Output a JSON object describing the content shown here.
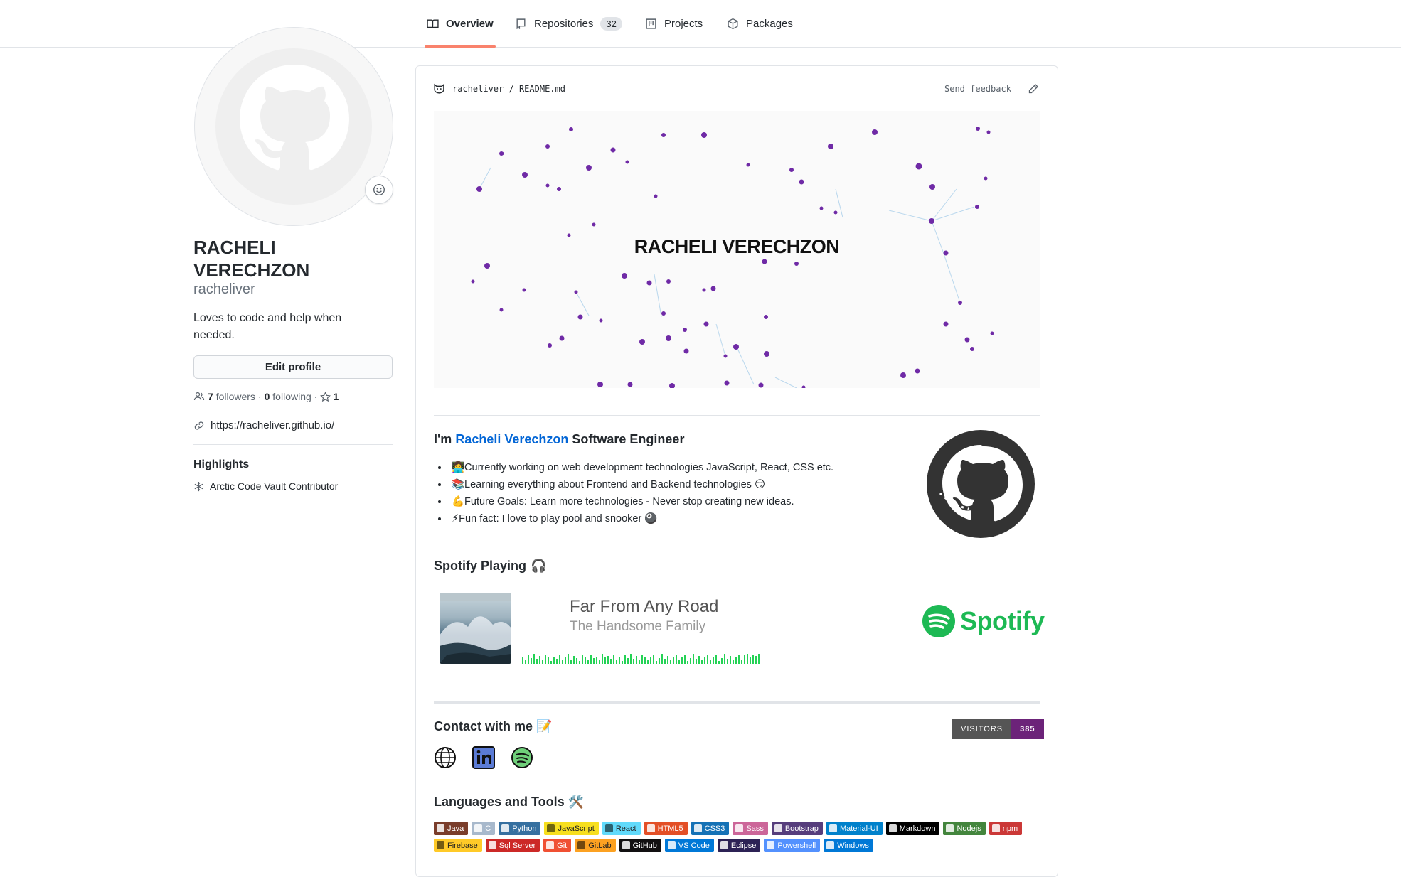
{
  "tabs": [
    {
      "label": "Overview",
      "icon": "book-icon",
      "selected": true
    },
    {
      "label": "Repositories",
      "icon": "repo-icon",
      "count": "32"
    },
    {
      "label": "Projects",
      "icon": "project-icon"
    },
    {
      "label": "Packages",
      "icon": "package-icon"
    }
  ],
  "profile": {
    "name_line1": "RACHELI",
    "name_line2": "VERECHZON",
    "username": "racheliver",
    "bio": "Loves to code and help when needed.",
    "edit_label": "Edit profile",
    "followers_count": "7",
    "followers_label": "followers",
    "separator": "·",
    "following_count": "0",
    "following_label": "following",
    "stars_count": "1",
    "website": "https://racheliver.github.io/",
    "highlights_title": "Highlights",
    "highlight_item": "Arctic Code Vault Contributor"
  },
  "readme": {
    "owner": "racheliver",
    "slash": "/",
    "file": "README.md",
    "feedback": "Send feedback",
    "banner_title": "RACHELI VERECHZON",
    "intro_prefix": "I'm",
    "intro_name": "Racheli Verechzon",
    "intro_suffix": "Software Engineer",
    "bullets": [
      "👩‍💻Currently working on web development technologies JavaScript, React, CSS etc.",
      "📚Learning everything about Frontend and Backend technologies 😏",
      "💪Future Goals: Learn more technologies - Never stop creating new ideas.",
      "⚡Fun fact: I love to play pool and snooker 🎱"
    ],
    "spotify_title": "Spotify Playing",
    "spotify_emoji": "🎧",
    "song": "Far From Any Road",
    "artist": "The Handsome Family",
    "spotify_brand": "Spotify",
    "contact_title": "Contact with me 📝",
    "visitors_label": "VISITORS",
    "visitors_count": "385",
    "tools_title": "Languages and Tools 🛠️"
  },
  "badges": [
    {
      "label": "Java",
      "color": "#7a3d2b"
    },
    {
      "label": "C",
      "color": "#a8b9cc"
    },
    {
      "label": "Python",
      "color": "#3670a0"
    },
    {
      "label": "JavaScript",
      "color": "#f7df1e",
      "dark": true
    },
    {
      "label": "React",
      "color": "#61dafb",
      "dark": true
    },
    {
      "label": "HTML5",
      "color": "#e34f26"
    },
    {
      "label": "CSS3",
      "color": "#1572b6"
    },
    {
      "label": "Sass",
      "color": "#cc6699"
    },
    {
      "label": "Bootstrap",
      "color": "#563d7c"
    },
    {
      "label": "Material-UI",
      "color": "#0081cb"
    },
    {
      "label": "Markdown",
      "color": "#000000"
    },
    {
      "label": "Nodejs",
      "color": "#43853d"
    },
    {
      "label": "npm",
      "color": "#cb3837"
    },
    {
      "label": "Firebase",
      "color": "#ffca28",
      "dark": true
    },
    {
      "label": "Sql Server",
      "color": "#cc2927"
    },
    {
      "label": "Git",
      "color": "#f05033"
    },
    {
      "label": "GitLab",
      "color": "#fca121",
      "dark": true
    },
    {
      "label": "GitHub",
      "color": "#121011"
    },
    {
      "label": "VS Code",
      "color": "#0078d7"
    },
    {
      "label": "Eclipse",
      "color": "#2c2255"
    },
    {
      "label": "Powershell",
      "color": "#5391fe"
    },
    {
      "label": "Windows",
      "color": "#0078d6"
    }
  ],
  "colors": {
    "tab_underline": "#f9826c",
    "link": "#0366d6",
    "spotify_green": "#1db954",
    "visitors": "#6c2379"
  }
}
